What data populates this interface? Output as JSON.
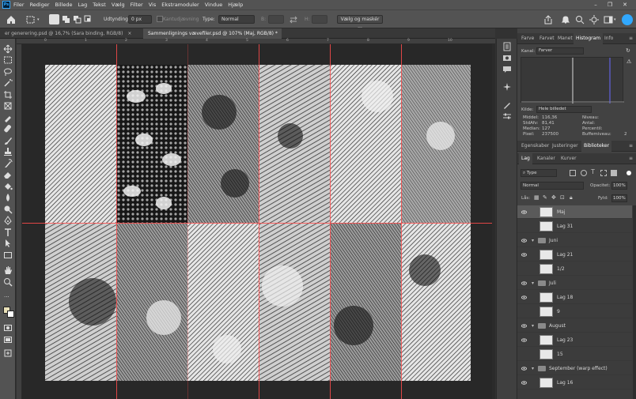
{
  "app": {
    "logo": "Ps"
  },
  "menu": [
    "Filer",
    "Rediger",
    "Billede",
    "Lag",
    "Tekst",
    "Vælg",
    "Filter",
    "Vis",
    "Ekstramoduler",
    "Vindue",
    "Hjælp"
  ],
  "options": {
    "feather_label": "Udtynding:",
    "feather_value": "0 px",
    "antialias_label": "Kantudjævning",
    "type_label": "Type:",
    "type_value": "Normal",
    "w_label": "B:",
    "h_label": "H:",
    "select_mask": "Vælg og maskér ..."
  },
  "tabs": [
    {
      "label": "er generering.psd @ 16,7% (Sara binding, RGB/8)",
      "close": "×"
    },
    {
      "label": "Sammenlignings vævefiler.psd @ 107% (Maj, RGB/8) *",
      "close": "×"
    }
  ],
  "ruler_numbers": [
    "0",
    "1",
    "2",
    "3",
    "4",
    "5",
    "6",
    "7",
    "8",
    "9",
    "10"
  ],
  "histogram_panel": {
    "tabs": [
      "Farve",
      "Farvet",
      "Manet",
      "Histogram",
      "Info"
    ],
    "active_tab": "Histogram",
    "kanal_label": "Kanal:",
    "kanal_value": "Farver",
    "kilde_label": "Kilde:",
    "kilde_value": "Hele billedet",
    "stats": [
      {
        "label": "Middel:",
        "value": "116,36"
      },
      {
        "label": "StdAfv:",
        "value": "81,41"
      },
      {
        "label": "Median:",
        "value": "127"
      },
      {
        "label": "Pixel:",
        "value": "237500"
      }
    ],
    "stats_right": [
      {
        "label": "Niveau:",
        "value": ""
      },
      {
        "label": "Antal:",
        "value": ""
      },
      {
        "label": "Percentil:",
        "value": ""
      },
      {
        "label": "Buffemiveau:",
        "value": "2"
      }
    ]
  },
  "properties_panel": {
    "tabs": [
      "Egenskaber",
      "Justeringer",
      "Biblioteker"
    ],
    "active_tab": "Biblioteker"
  },
  "layers_panel": {
    "tabs": [
      "Lag",
      "Kanaler",
      "Kurver"
    ],
    "active_tab": "Lag",
    "filter_value": "Type",
    "blend_mode": "Normal",
    "opacity_label": "Opacitet:",
    "opacity_value": "100%",
    "lock_label": "Lås:",
    "fill_label": "Fyld:",
    "fill_value": "100%",
    "layers": [
      {
        "kind": "layer",
        "name": "Maj",
        "selected": true,
        "visible": true
      },
      {
        "kind": "layer",
        "name": "Lag 31",
        "selected": false,
        "visible": false
      },
      {
        "kind": "group",
        "name": "Juni",
        "visible": true
      },
      {
        "kind": "layer",
        "name": "Lag 21",
        "selected": false,
        "visible": true
      },
      {
        "kind": "layer",
        "name": "1/2",
        "selected": false,
        "visible": false
      },
      {
        "kind": "group",
        "name": "Juli",
        "visible": true
      },
      {
        "kind": "layer",
        "name": "Lag 18",
        "selected": false,
        "visible": true
      },
      {
        "kind": "layer",
        "name": "9",
        "selected": false,
        "visible": false
      },
      {
        "kind": "group",
        "name": "August",
        "visible": true
      },
      {
        "kind": "layer",
        "name": "Lag 23",
        "selected": false,
        "visible": true
      },
      {
        "kind": "layer",
        "name": "15",
        "selected": false,
        "visible": false
      },
      {
        "kind": "group",
        "name": "September (warp effect)",
        "visible": true
      },
      {
        "kind": "layer",
        "name": "Lag 16",
        "selected": false,
        "visible": true
      }
    ]
  },
  "colors": {
    "guide": "#ff4b4b",
    "accent": "#31a8ff",
    "panel_bg": "#424242"
  }
}
